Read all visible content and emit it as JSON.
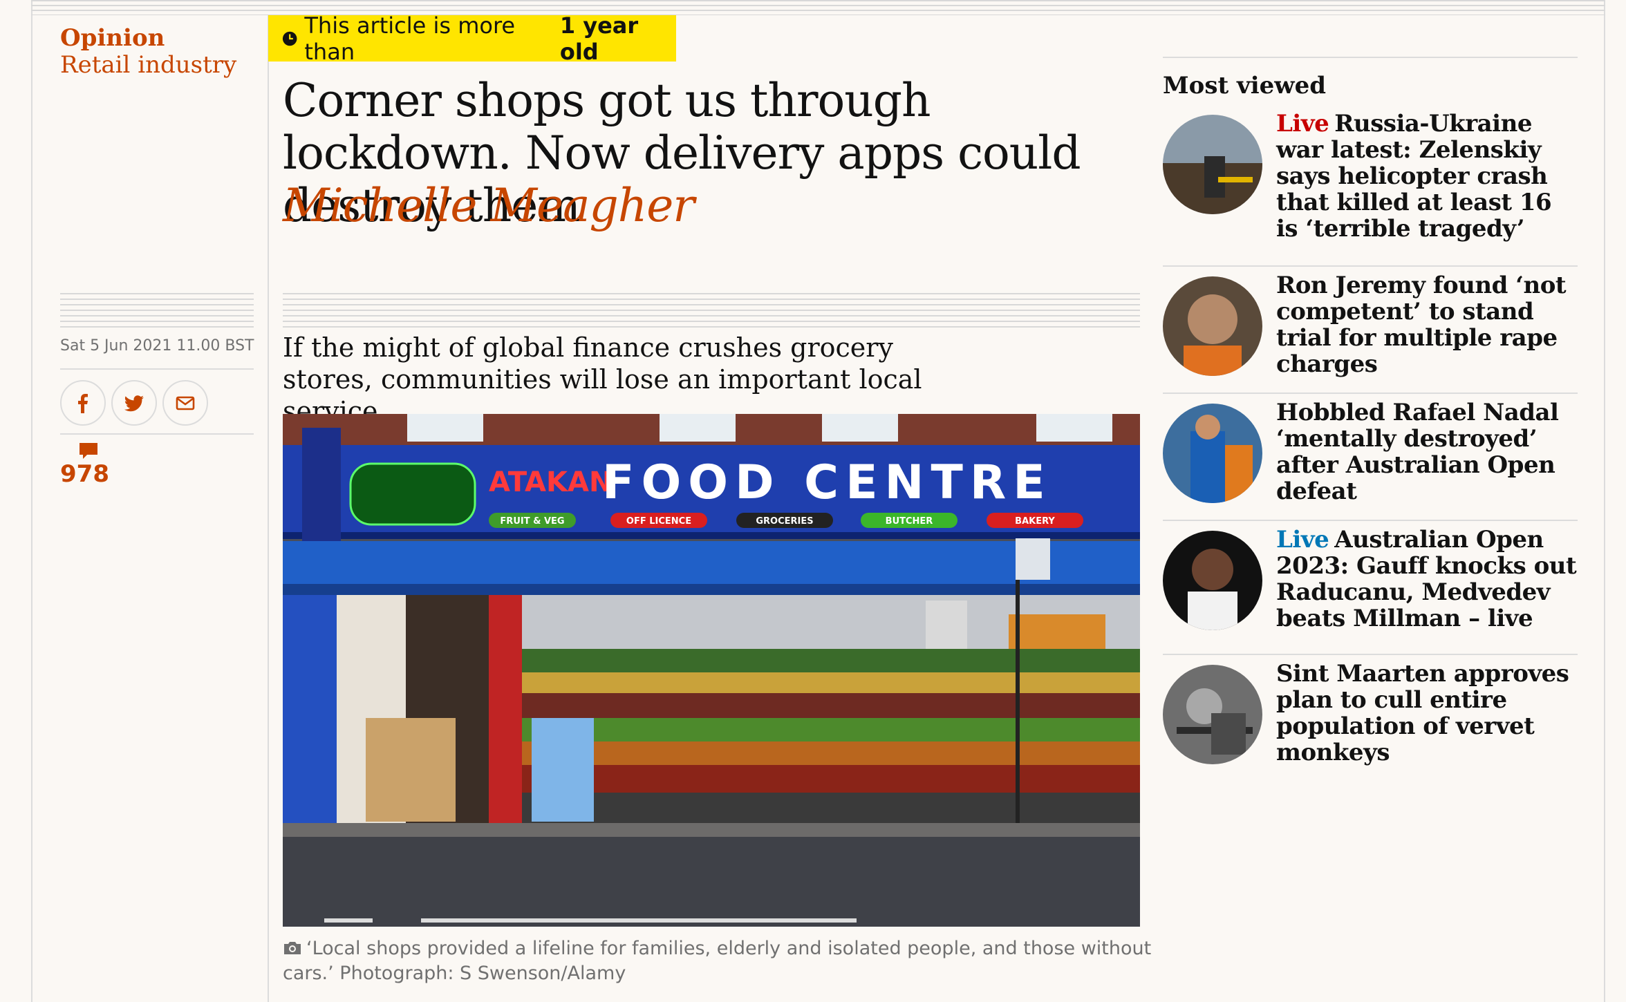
{
  "section": {
    "pillar": "Opinion",
    "series": "Retail industry"
  },
  "age_warning": {
    "prefix": "This article is more than",
    "age": "1 year old"
  },
  "article": {
    "headline": "Corner shops got us through lockdown. Now delivery apps could destroy them",
    "byline": "Michelle Meagher",
    "standfirst": "If the might of global finance crushes grocery stores, communities will lose an important local service",
    "dateline": "Sat 5 Jun 2021 11.00 BST",
    "comment_count": "978",
    "caption": "‘Local shops provided a lifeline for families, elderly and isolated people, and those without cars.’ Photograph: S Swenson/Alamy"
  },
  "photo": {
    "store_name": "ATAKAN",
    "sign": "FOOD CENTRE",
    "pills": [
      "FRUIT & VEG",
      "OFF LICENCE",
      "GROCERIES",
      "BUTCHER",
      "BAKERY"
    ]
  },
  "share": {
    "icons": [
      "facebook-icon",
      "twitter-icon",
      "email-icon"
    ]
  },
  "most_viewed": {
    "heading": "Most viewed",
    "items": [
      {
        "kicker": "Live",
        "kicker_color": "#c70000",
        "title": "Russia-Ukraine war latest: Zelenskiy says helicopter crash that killed at least 16 is ‘terrible tragedy’"
      },
      {
        "kicker": "",
        "kicker_color": "",
        "title": "Ron Jeremy found ‘not competent’ to stand trial for multiple rape charges"
      },
      {
        "kicker": "",
        "kicker_color": "",
        "title": "Hobbled Rafael Nadal ‘mentally destroyed’ after Australian Open defeat"
      },
      {
        "kicker": "Live",
        "kicker_color": "#0077b6",
        "title": "Australian Open 2023: Gauff knocks out Raducanu, Medvedev beats Millman – live"
      },
      {
        "kicker": "",
        "kicker_color": "",
        "title": "Sint Maarten approves plan to cull entire population of vervet monkeys"
      }
    ]
  },
  "colors": {
    "opinion_orange": "#c74600",
    "live_red": "#c70000",
    "live_blue": "#0077b6",
    "warning_yellow": "#ffe500"
  }
}
